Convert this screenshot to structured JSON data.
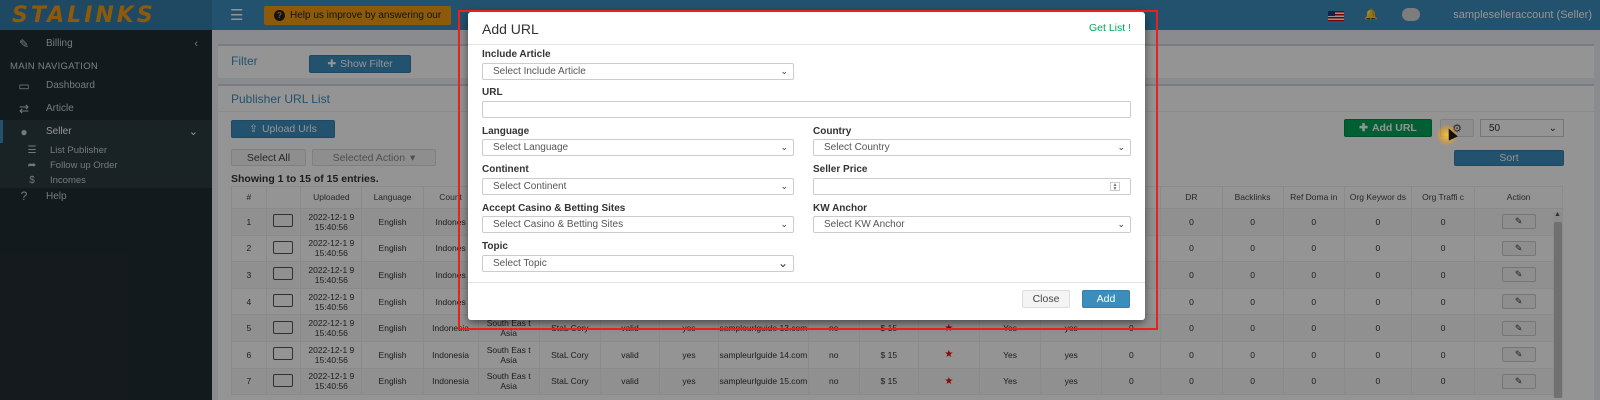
{
  "app": {
    "logo": "STALINKS"
  },
  "topbar": {
    "survey_text": "Help us improve by answering our",
    "user": "sampleselleraccount (Seller)"
  },
  "sidebar": {
    "billing": "Billing",
    "header": "MAIN NAVIGATION",
    "items": [
      {
        "label": "Dashboard",
        "icon": "monitor-icon"
      },
      {
        "label": "Article",
        "icon": "random-icon"
      },
      {
        "label": "Seller",
        "icon": "user-icon"
      }
    ],
    "sub_items": [
      {
        "label": "List Publisher",
        "icon": "list-icon"
      },
      {
        "label": "Follow up Order",
        "icon": "share-icon"
      },
      {
        "label": "Incomes",
        "icon": "dollar-icon"
      }
    ],
    "help": "Help"
  },
  "filter": {
    "title": "Filter",
    "show_filter": "Show Filter"
  },
  "list": {
    "title": "Publisher URL List",
    "upload": "Upload Urls",
    "select_all": "Select All",
    "selected_action": "Selected Action",
    "showing": "Showing 1 to 15 of 15 entries.",
    "add_url": "Add URL",
    "page_size": "50",
    "sort": "Sort",
    "columns": [
      "#",
      "",
      "Uploaded",
      "Language",
      "Count",
      "",
      "",
      "",
      "",
      "",
      "",
      "",
      "",
      "",
      "",
      "",
      "R",
      "DR",
      "Backlinks",
      "Ref Doma in",
      "Org Keywor ds",
      "Org Traffi c",
      "Action"
    ],
    "rows": [
      {
        "num": "1",
        "uploaded": "2022-12-1 9 15:40:56",
        "language": "English",
        "country": "Indones",
        "continent": "",
        "seller": "",
        "valid": "",
        "casino": "",
        "url": "",
        "kw": "",
        "price": "",
        "star": false,
        "a": "",
        "b": "",
        "r": "0",
        "dr": "0",
        "backlinks": "0",
        "ref": "0",
        "kwds": "0",
        "traffic": "0"
      },
      {
        "num": "2",
        "uploaded": "2022-12-1 9 15:40:56",
        "language": "English",
        "country": "Indones",
        "continent": "",
        "seller": "",
        "valid": "",
        "casino": "",
        "url": "",
        "kw": "",
        "price": "",
        "star": false,
        "a": "",
        "b": "",
        "r": "0",
        "dr": "0",
        "backlinks": "0",
        "ref": "0",
        "kwds": "0",
        "traffic": "0"
      },
      {
        "num": "3",
        "uploaded": "2022-12-1 9 15:40:56",
        "language": "English",
        "country": "Indones",
        "continent": "",
        "seller": "",
        "valid": "",
        "casino": "",
        "url": "",
        "kw": "",
        "price": "",
        "star": false,
        "a": "",
        "b": "",
        "r": "0",
        "dr": "0",
        "backlinks": "0",
        "ref": "0",
        "kwds": "0",
        "traffic": "0"
      },
      {
        "num": "4",
        "uploaded": "2022-12-1 9 15:40:56",
        "language": "English",
        "country": "Indones",
        "continent": "",
        "seller": "",
        "valid": "",
        "casino": "",
        "url": "",
        "kw": "",
        "price": "",
        "star": false,
        "a": "",
        "b": "",
        "r": "0",
        "dr": "0",
        "backlinks": "0",
        "ref": "0",
        "kwds": "0",
        "traffic": "0"
      },
      {
        "num": "5",
        "uploaded": "2022-12-1 9 15:40:56",
        "language": "English",
        "country": "Indonesia",
        "continent": "South Eas t Asia",
        "seller": "StaL Cory",
        "valid": "valid",
        "casino": "yes",
        "url": "sampleurlguide 13.com",
        "kw": "no",
        "price": "$ 15",
        "star": true,
        "a": "Yes",
        "b": "yes",
        "r": "0",
        "dr": "0",
        "backlinks": "0",
        "ref": "0",
        "kwds": "0",
        "traffic": "0"
      },
      {
        "num": "6",
        "uploaded": "2022-12-1 9 15:40:56",
        "language": "English",
        "country": "Indonesia",
        "continent": "South Eas t Asia",
        "seller": "StaL Cory",
        "valid": "valid",
        "casino": "yes",
        "url": "sampleurlguide 14.com",
        "kw": "no",
        "price": "$ 15",
        "star": true,
        "a": "Yes",
        "b": "yes",
        "r": "0",
        "dr": "0",
        "backlinks": "0",
        "ref": "0",
        "kwds": "0",
        "traffic": "0"
      },
      {
        "num": "7",
        "uploaded": "2022-12-1 9 15:40:56",
        "language": "English",
        "country": "Indonesia",
        "continent": "South Eas t Asia",
        "seller": "StaL Cory",
        "valid": "valid",
        "casino": "yes",
        "url": "sampleurlguide 15.com",
        "kw": "no",
        "price": "$ 15",
        "star": true,
        "a": "Yes",
        "b": "yes",
        "r": "0",
        "dr": "0",
        "backlinks": "0",
        "ref": "0",
        "kwds": "0",
        "traffic": "0"
      }
    ]
  },
  "modal": {
    "title": "Add URL",
    "get_list": "Get List !",
    "include_article_label": "Include Article",
    "include_article_placeholder": "Select Include Article",
    "url_label": "URL",
    "url_value": "",
    "language_label": "Language",
    "language_placeholder": "Select Language",
    "country_label": "Country",
    "country_placeholder": "Select Country",
    "continent_label": "Continent",
    "continent_placeholder": "Select Continent",
    "seller_price_label": "Seller Price",
    "seller_price_value": "",
    "casino_label": "Accept Casino & Betting Sites",
    "casino_placeholder": "Select Casino & Betting Sites",
    "kw_anchor_label": "KW Anchor",
    "kw_anchor_placeholder": "Select KW Anchor",
    "topic_label": "Topic",
    "topic_placeholder": "Select Topic",
    "close": "Close",
    "add": "Add"
  },
  "colors": {
    "sidebar": "#222d32",
    "topbar": "#3c8dbc",
    "accent": "#f39c12",
    "success": "#00a65a",
    "highlight": "#e8221b"
  }
}
